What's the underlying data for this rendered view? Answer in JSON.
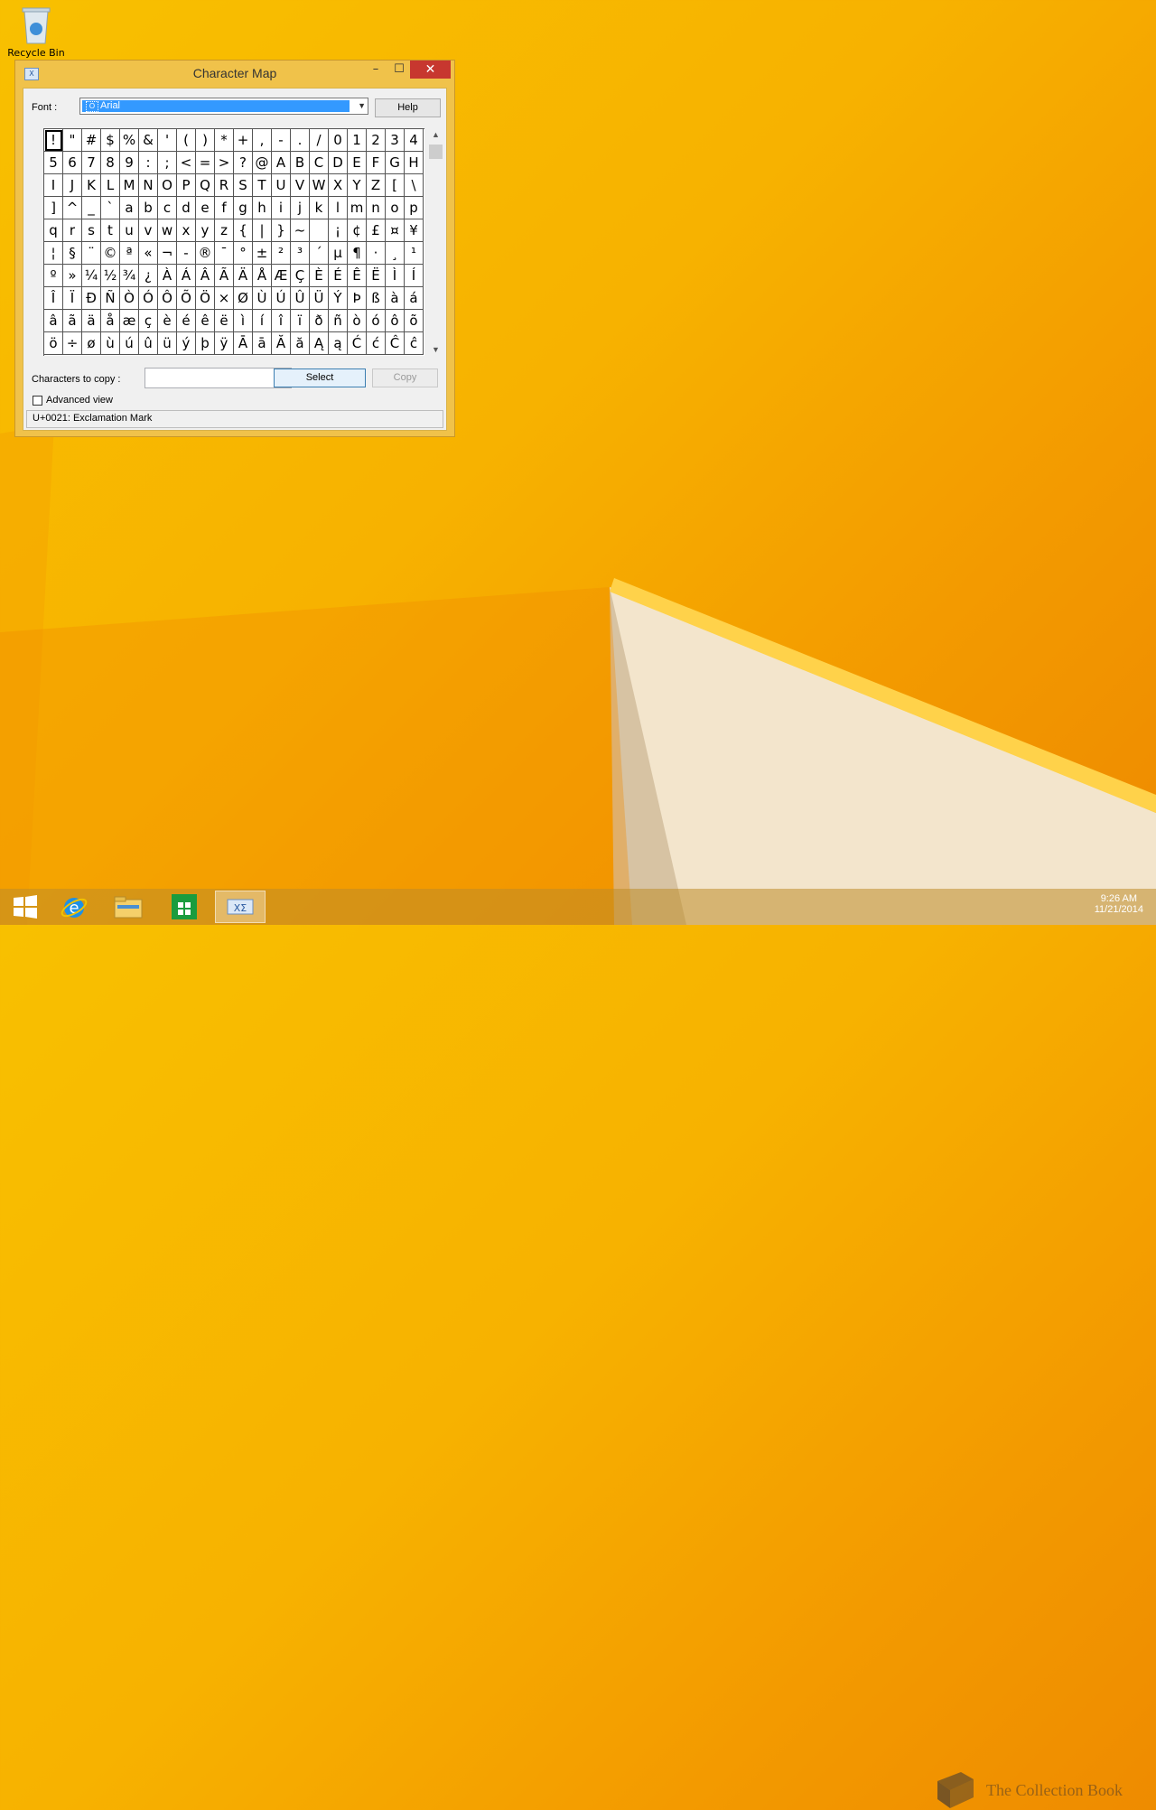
{
  "desktop": {
    "recycle_bin_label": "Recycle Bin"
  },
  "window": {
    "title": "Character Map",
    "minimize_symbol": "–",
    "maximize_symbol": "☐",
    "close_symbol": "✕"
  },
  "font": {
    "label": "Font :",
    "selected": "Arial",
    "help_label": "Help"
  },
  "characters": [
    "!",
    "\"",
    "#",
    "$",
    "%",
    "&",
    "'",
    "(",
    ")",
    "*",
    "+",
    ",",
    "-",
    ".",
    "/",
    "0",
    "1",
    "2",
    "3",
    "4",
    "5",
    "6",
    "7",
    "8",
    "9",
    ":",
    ";",
    "<",
    "=",
    ">",
    "?",
    "@",
    "A",
    "B",
    "C",
    "D",
    "E",
    "F",
    "G",
    "H",
    "I",
    "J",
    "K",
    "L",
    "M",
    "N",
    "O",
    "P",
    "Q",
    "R",
    "S",
    "T",
    "U",
    "V",
    "W",
    "X",
    "Y",
    "Z",
    "[",
    "\\",
    "]",
    "^",
    "_",
    "`",
    "a",
    "b",
    "c",
    "d",
    "e",
    "f",
    "g",
    "h",
    "i",
    "j",
    "k",
    "l",
    "m",
    "n",
    "o",
    "p",
    "q",
    "r",
    "s",
    "t",
    "u",
    "v",
    "w",
    "x",
    "y",
    "z",
    "{",
    "|",
    "}",
    "~",
    " ",
    "¡",
    "¢",
    "£",
    "¤",
    "¥",
    "¦",
    "§",
    "¨",
    "©",
    "ª",
    "«",
    "¬",
    "-",
    "®",
    "¯",
    "°",
    "±",
    "²",
    "³",
    "´",
    "µ",
    "¶",
    "·",
    "¸",
    "¹",
    "º",
    "»",
    "¼",
    "½",
    "¾",
    "¿",
    "À",
    "Á",
    "Â",
    "Ã",
    "Ä",
    "Å",
    "Æ",
    "Ç",
    "È",
    "É",
    "Ê",
    "Ë",
    "Ì",
    "Í",
    "Î",
    "Ï",
    "Ð",
    "Ñ",
    "Ò",
    "Ó",
    "Ô",
    "Õ",
    "Ö",
    "×",
    "Ø",
    "Ù",
    "Ú",
    "Û",
    "Ü",
    "Ý",
    "Þ",
    "ß",
    "à",
    "á",
    "â",
    "ã",
    "ä",
    "å",
    "æ",
    "ç",
    "è",
    "é",
    "ê",
    "ë",
    "ì",
    "í",
    "î",
    "ï",
    "ð",
    "ñ",
    "ò",
    "ó",
    "ô",
    "õ",
    "ö",
    "÷",
    "ø",
    "ù",
    "ú",
    "û",
    "ü",
    "ý",
    "þ",
    "ÿ",
    "Ā",
    "ā",
    "Ă",
    "ă",
    "Ą",
    "ą",
    "Ć",
    "ć",
    "Ĉ",
    "ĉ"
  ],
  "selected_character_index": 0,
  "copy": {
    "label": "Characters to copy :",
    "value": "",
    "select_label": "Select",
    "copy_label": "Copy"
  },
  "advanced_view": {
    "label": "Advanced view",
    "checked": false
  },
  "status": "U+0021: Exclamation Mark",
  "taskbar": {
    "items": [
      "Start",
      "Internet Explorer",
      "File Explorer",
      "Store",
      "Character Map"
    ],
    "active_index": 4,
    "clock_time": "9:26 AM",
    "clock_date": "11/21/2014"
  },
  "watermark": "The Collection Book",
  "colors": {
    "window_frame": "#f0c24a",
    "close_button": "#c7372f",
    "selection": "#3399ff"
  }
}
